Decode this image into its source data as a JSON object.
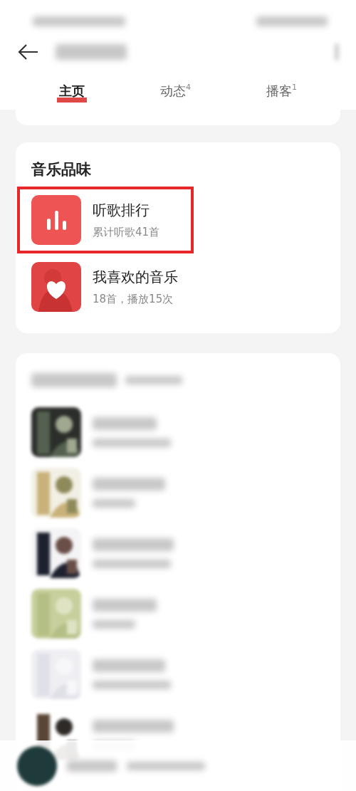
{
  "status_bar": {
    "kind": "blurred"
  },
  "header": {
    "title": {
      "kind": "blurred"
    }
  },
  "tabs": [
    {
      "label": "主页",
      "selected": true
    },
    {
      "label": "动态",
      "badge": "4",
      "selected": false
    },
    {
      "label": "播客",
      "badge": "1",
      "selected": false
    }
  ],
  "music_taste": {
    "title": "音乐品味",
    "items": [
      {
        "kind": "chart",
        "title": "听歌排行",
        "subtitle": "累计听歌41首",
        "highlighted": true
      },
      {
        "kind": "liked",
        "title": "我喜欢的音乐",
        "subtitle": "18首，播放15次",
        "highlighted": false
      }
    ]
  },
  "playlists": {
    "kind": "blurred"
  },
  "mini_player": {
    "kind": "blurred"
  }
}
